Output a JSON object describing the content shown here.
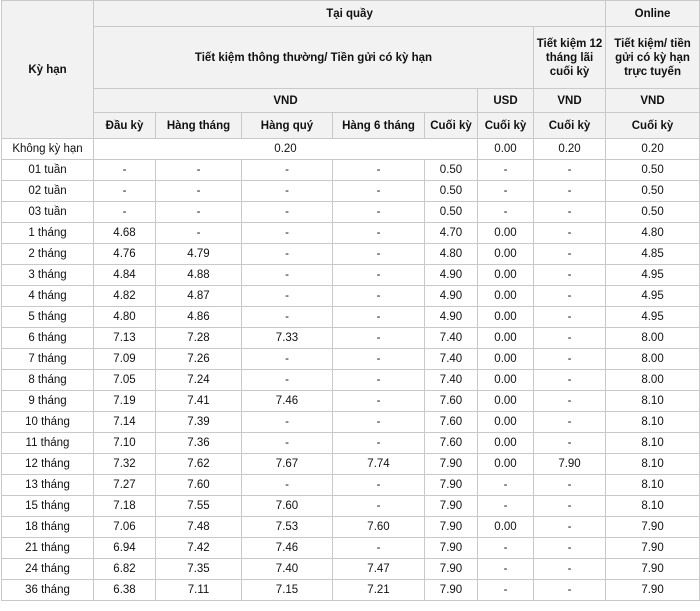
{
  "header": {
    "ky_han": "Kỳ hạn",
    "tai_quay": "Tại quầy",
    "online": "Online",
    "tiet_kiem_group": "Tiết kiệm thông thường/ Tiền gửi có kỳ hạn",
    "tiet_kiem_12": "Tiết kiệm 12 tháng lãi cuối kỳ",
    "online_desc": "Tiết kiệm/ tiền gửi có kỳ hạn trực tuyến",
    "vnd": "VND",
    "usd": "USD",
    "cols": [
      "Đầu kỳ",
      "Hàng tháng",
      "Hàng quý",
      "Hàng 6 tháng",
      "Cuối kỳ",
      "Cuối kỳ",
      "Cuối kỳ",
      "Cuối  kỳ"
    ]
  },
  "row_khong_ky_han": {
    "term": "Không kỳ hạn",
    "vnd_all": "0.20",
    "usd": "0.00",
    "tk12": "0.20",
    "online": "0.20"
  },
  "rows": [
    [
      "01 tuần",
      "-",
      "-",
      "-",
      "-",
      "0.50",
      "-",
      "-",
      "0.50"
    ],
    [
      "02 tuần",
      "-",
      "-",
      "-",
      "-",
      "0.50",
      "-",
      "-",
      "0.50"
    ],
    [
      "03 tuần",
      "-",
      "-",
      "-",
      "-",
      "0.50",
      "-",
      "-",
      "0.50"
    ],
    [
      "1 tháng",
      "4.68",
      "-",
      "-",
      "-",
      "4.70",
      "0.00",
      "-",
      "4.80"
    ],
    [
      "2 tháng",
      "4.76",
      "4.79",
      "-",
      "-",
      "4.80",
      "0.00",
      "-",
      "4.85"
    ],
    [
      "3 tháng",
      "4.84",
      "4.88",
      "-",
      "-",
      "4.90",
      "0.00",
      "-",
      "4.95"
    ],
    [
      "4 tháng",
      "4.82",
      "4.87",
      "-",
      "-",
      "4.90",
      "0.00",
      "-",
      "4.95"
    ],
    [
      "5 tháng",
      "4.80",
      "4.86",
      "-",
      "-",
      "4.90",
      "0.00",
      "-",
      "4.95"
    ],
    [
      "6 tháng",
      "7.13",
      "7.28",
      "7.33",
      "-",
      "7.40",
      "0.00",
      "-",
      "8.00"
    ],
    [
      "7  tháng",
      "7.09",
      "7.26",
      "-",
      "-",
      "7.40",
      "0.00",
      "-",
      "8.00"
    ],
    [
      "8 tháng",
      "7.05",
      "7.24",
      "-",
      "-",
      "7.40",
      "0.00",
      "-",
      "8.00"
    ],
    [
      "9 tháng",
      "7.19",
      "7.41",
      "7.46",
      "-",
      "7.60",
      "0.00",
      "-",
      "8.10"
    ],
    [
      "10 tháng",
      "7.14",
      "7.39",
      "-",
      "-",
      "7.60",
      "0.00",
      "-",
      "8.10"
    ],
    [
      "11 tháng",
      "7.10",
      "7.36",
      "-",
      "-",
      "7.60",
      "0.00",
      "-",
      "8.10"
    ],
    [
      "12 tháng",
      "7.32",
      "7.62",
      "7.67",
      "7.74",
      "7.90",
      "0.00",
      "7.90",
      "8.10"
    ],
    [
      "13 tháng",
      "7.27",
      "7.60",
      "-",
      "-",
      "7.90",
      "-",
      "-",
      "8.10"
    ],
    [
      "15 tháng",
      "7.18",
      "7.55",
      "7.60",
      "-",
      "7.90",
      "-",
      "-",
      "8.10"
    ],
    [
      "18 tháng",
      "7.06",
      "7.48",
      "7.53",
      "7.60",
      "7.90",
      "0.00",
      "-",
      "7.90"
    ],
    [
      "21 tháng",
      "6.94",
      "7.42",
      "7.46",
      "-",
      "7.90",
      "-",
      "-",
      "7.90"
    ],
    [
      "24 tháng",
      "6.82",
      "7.35",
      "7.40",
      "7.47",
      "7.90",
      "-",
      "-",
      "7.90"
    ],
    [
      "36 tháng",
      "6.38",
      "7.11",
      "7.15",
      "7.21",
      "7.90",
      "-",
      "-",
      "7.90"
    ]
  ]
}
